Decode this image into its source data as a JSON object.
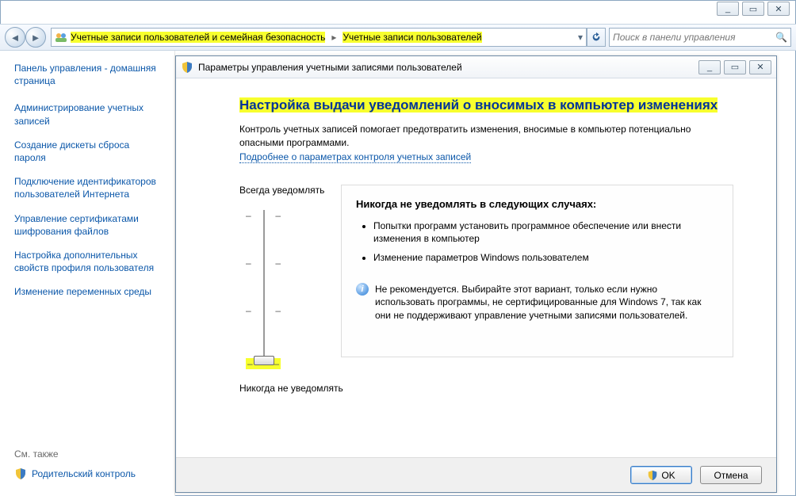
{
  "windowControls": {
    "min": "_",
    "max": "▭",
    "close": "✕"
  },
  "toolbar": {
    "breadcrumb": {
      "part1": "Учетные записи пользователей и семейная безопасность",
      "part2": "Учетные записи пользователей"
    },
    "search_placeholder": "Поиск в панели управления"
  },
  "sidebar": {
    "home": "Панель управления - домашняя страница",
    "tasks": [
      "Администрирование учетных записей",
      "Создание дискеты сброса пароля",
      "Подключение идентификаторов пользователей Интернета",
      "Управление сертификатами шифрования файлов",
      "Настройка дополнительных свойств профиля пользователя",
      "Изменение переменных среды"
    ],
    "see_also_label": "См. также",
    "parental": "Родительский контроль"
  },
  "subwindow": {
    "title": "Параметры управления учетными записями пользователей",
    "heading": "Настройка выдачи уведомлений о вносимых в компьютер изменениях",
    "desc1": "Контроль учетных записей помогает предотвратить изменения, вносимые в компьютер потенциально опасными программами.",
    "desc_link": "Подробнее о параметрах контроля учетных записей",
    "slider": {
      "top_label": "Всегда уведомлять",
      "bottom_label": "Никогда не уведомлять"
    },
    "detail": {
      "title": "Никогда не уведомлять в следующих случаях:",
      "bullets": [
        "Попытки программ установить программное обеспечение или внести изменения в компьютер",
        "Изменение параметров Windows пользователем"
      ],
      "note": "Не рекомендуется. Выбирайте этот вариант, только если нужно использовать программы, не сертифицированные для Windows 7, так как они не поддерживают управление учетными записями пользователей."
    },
    "buttons": {
      "ok": "OK",
      "cancel": "Отмена"
    }
  }
}
